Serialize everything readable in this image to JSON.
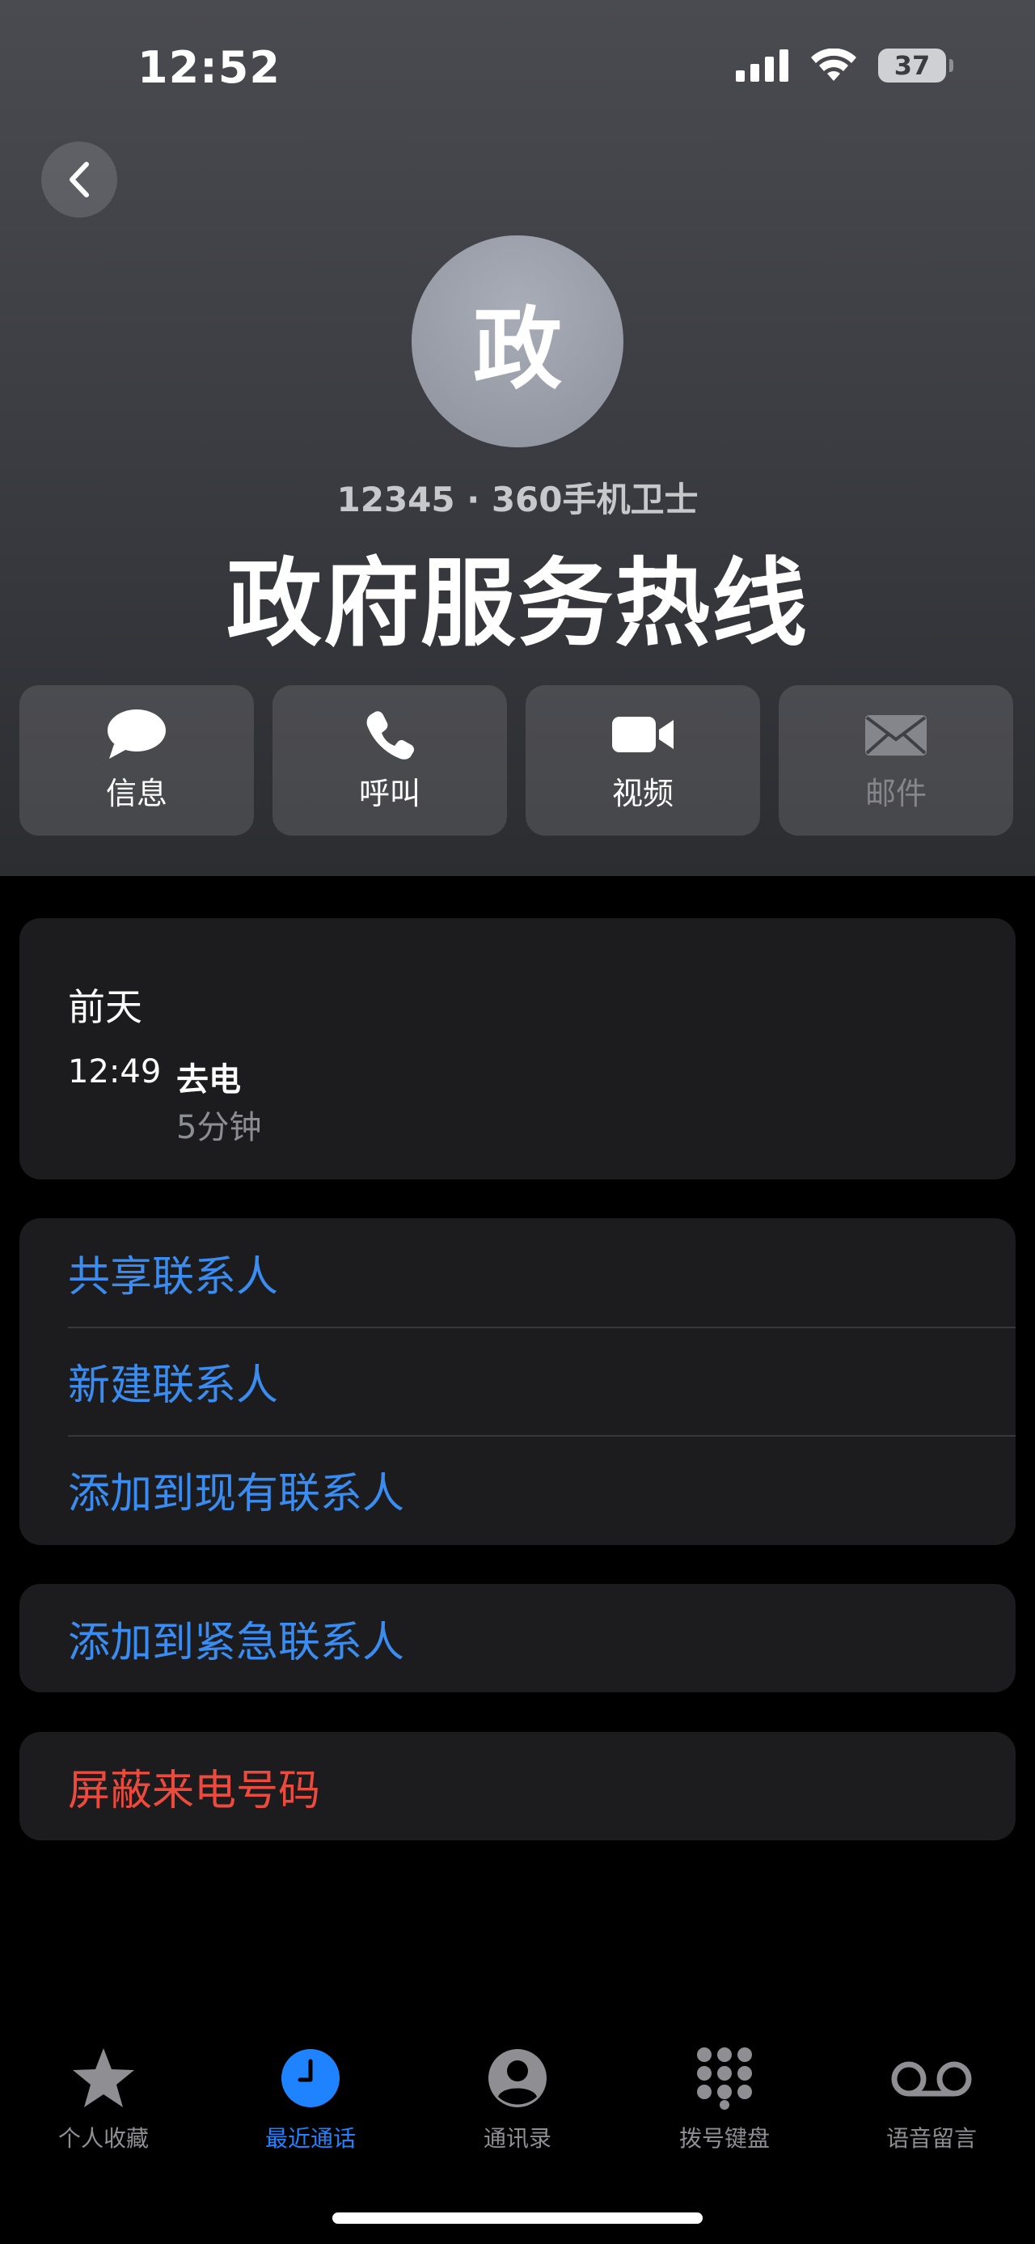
{
  "status_bar": {
    "time": "12:52",
    "battery": "37"
  },
  "header": {
    "avatar_text": "政",
    "subtitle": "12345 · 360手机卫士",
    "title": "政府服务热线"
  },
  "actions": [
    {
      "label": "信息",
      "icon": "message-bubble-icon"
    },
    {
      "label": "呼叫",
      "icon": "phone-icon"
    },
    {
      "label": "视频",
      "icon": "video-camera-icon"
    },
    {
      "label": "邮件",
      "icon": "mail-envelope-icon",
      "disabled": true
    }
  ],
  "call_history": {
    "day": "前天",
    "entries": [
      {
        "time": "12:49",
        "type": "去电",
        "duration": "5分钟"
      }
    ]
  },
  "contact_options": [
    "共享联系人",
    "新建联系人",
    "添加到现有联系人"
  ],
  "emergency": "添加到紧急联系人",
  "block": "屏蔽来电号码",
  "tabs": [
    {
      "label": "个人收藏",
      "icon": "star-icon"
    },
    {
      "label": "最近通话",
      "icon": "clock-icon",
      "active": true
    },
    {
      "label": "通讯录",
      "icon": "person-circle-icon"
    },
    {
      "label": "拨号键盘",
      "icon": "keypad-icon"
    },
    {
      "label": "语音留言",
      "icon": "voicemail-icon"
    }
  ],
  "colors": {
    "accent": "#3a8cf0",
    "destructive": "#ec4a3d",
    "tab_active": "#1f83ff"
  }
}
